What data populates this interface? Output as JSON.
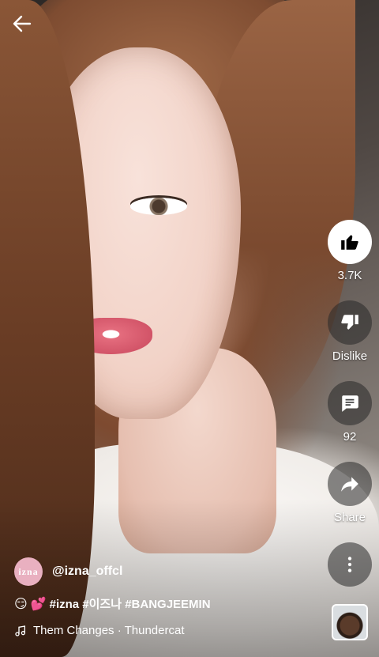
{
  "actions": {
    "like_count": "3.7K",
    "dislike_label": "Dislike",
    "comment_count": "92",
    "share_label": "Share"
  },
  "channel": {
    "avatar_text": "izna",
    "handle": "@izna_offcl"
  },
  "caption": {
    "emoji_1": "😏",
    "emoji_2": "💕",
    "text": "#izna #이즈나 #BANGJEEMIN"
  },
  "music": {
    "track": "Them Changes · Thundercat"
  },
  "icons": [
    "back-arrow-icon",
    "thumbs-up-icon",
    "thumbs-down-icon",
    "comment-icon",
    "share-icon",
    "more-icon",
    "music-note-icon"
  ]
}
